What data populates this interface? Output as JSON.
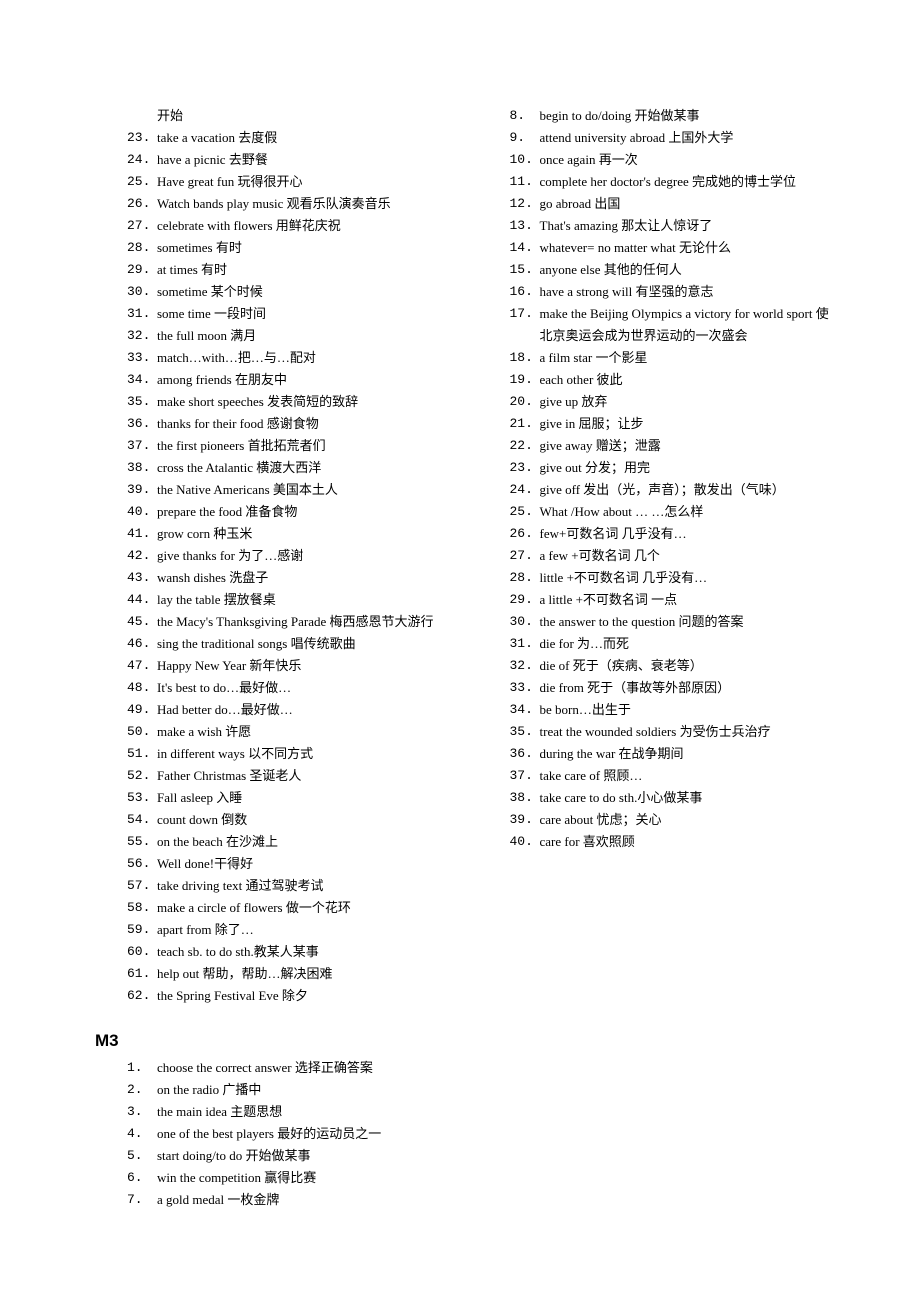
{
  "col1_first": {
    "text": "开始"
  },
  "col1": [
    {
      "n": "23.",
      "t": "take a vacation 去度假"
    },
    {
      "n": "24.",
      "t": " have a picnic 去野餐"
    },
    {
      "n": "25.",
      "t": "Have great fun 玩得很开心"
    },
    {
      "n": "26.",
      "t": "Watch bands play music 观看乐队演奏音乐"
    },
    {
      "n": "27.",
      "t": "celebrate with flowers 用鲜花庆祝"
    },
    {
      "n": "28.",
      "t": "sometimes 有时"
    },
    {
      "n": "29.",
      "t": "at times 有时"
    },
    {
      "n": "30.",
      "t": "sometime 某个时候"
    },
    {
      "n": "31.",
      "t": "some time 一段时间"
    },
    {
      "n": "32.",
      "t": "the full moon 满月"
    },
    {
      "n": "33.",
      "t": "match…with…把…与…配对"
    },
    {
      "n": "34.",
      "t": "among friends 在朋友中"
    },
    {
      "n": "35.",
      "t": "make short speeches 发表简短的致辞"
    },
    {
      "n": "36.",
      "t": "thanks for their food 感谢食物"
    },
    {
      "n": "37.",
      "t": "the first pioneers 首批拓荒者们"
    },
    {
      "n": "38.",
      "t": "cross the Atalantic 横渡大西洋"
    },
    {
      "n": "39.",
      "t": "the Native Americans 美国本土人"
    },
    {
      "n": "40.",
      "t": "prepare the food 准备食物"
    },
    {
      "n": "41.",
      "t": "grow corn 种玉米"
    },
    {
      "n": "42.",
      "t": "give thanks for 为了…感谢"
    },
    {
      "n": "43.",
      "t": "wansh dishes 洗盘子"
    },
    {
      "n": "44.",
      "t": "lay the table 摆放餐桌"
    },
    {
      "n": "45.",
      "t": "the Macy's Thanksgiving Parade 梅西感恩节大游行"
    },
    {
      "n": "46.",
      "t": "sing the traditional songs 唱传统歌曲"
    },
    {
      "n": "47.",
      "t": "Happy New Year 新年快乐"
    },
    {
      "n": "48.",
      "t": "It's best to do…最好做…"
    },
    {
      "n": "49.",
      "t": "Had better do…最好做…"
    },
    {
      "n": "50.",
      "t": "make a wish 许愿"
    },
    {
      "n": "51.",
      "t": "in different ways 以不同方式"
    },
    {
      "n": "52.",
      "t": "Father Christmas 圣诞老人"
    },
    {
      "n": "53.",
      "t": "Fall asleep 入睡"
    },
    {
      "n": "54.",
      "t": "count down 倒数"
    },
    {
      "n": "55.",
      "t": "on the beach 在沙滩上"
    },
    {
      "n": "56.",
      "t": "Well done!干得好"
    },
    {
      "n": "57.",
      "t": "take driving text 通过驾驶考试"
    },
    {
      "n": "58.",
      "t": "make a circle of flowers 做一个花环"
    },
    {
      "n": "59.",
      "t": "apart from 除了…"
    },
    {
      "n": "60.",
      "t": "teach sb. to do sth.教某人某事"
    },
    {
      "n": "61.",
      "t": "help out 帮助，帮助…解决困难"
    },
    {
      "n": "62.",
      "t": "the Spring Festival Eve 除夕"
    }
  ],
  "heading": "M3",
  "col2": [
    {
      "n": "1.",
      "t": "choose the correct answer 选择正确答案"
    },
    {
      "n": "2.",
      "t": "on the radio 广播中"
    },
    {
      "n": "3.",
      "t": "the main idea 主题思想"
    },
    {
      "n": "4.",
      "t": "one of the best players 最好的运动员之一"
    },
    {
      "n": "5.",
      "t": "start doing/to do 开始做某事"
    },
    {
      "n": "6.",
      "t": "win the competition 赢得比赛"
    },
    {
      "n": "7.",
      "t": "a gold medal 一枚金牌"
    },
    {
      "n": "8.",
      "t": "begin to do/doing 开始做某事"
    },
    {
      "n": "9.",
      "t": "attend university abroad 上国外大学"
    },
    {
      "n": "10.",
      "t": "once again 再一次"
    },
    {
      "n": "11.",
      "t": "complete her doctor's degree 完成她的博士学位"
    },
    {
      "n": "12.",
      "t": "go abroad 出国"
    },
    {
      "n": "13.",
      "t": "That's amazing 那太让人惊讶了"
    },
    {
      "n": "14.",
      "t": "whatever= no matter what 无论什么"
    },
    {
      "n": "15.",
      "t": "anyone else 其他的任何人"
    },
    {
      "n": "16.",
      "t": "have a strong will 有坚强的意志"
    },
    {
      "n": "17.",
      "t": "make the Beijing Olympics a victory for world sport 使北京奥运会成为世界运动的一次盛会"
    },
    {
      "n": "18.",
      "t": "a film star 一个影星"
    },
    {
      "n": "19.",
      "t": "each other 彼此"
    },
    {
      "n": "20.",
      "t": "give up 放弃"
    },
    {
      "n": "21.",
      "t": "give in 屈服；让步"
    },
    {
      "n": "22.",
      "t": "give away 赠送；泄露"
    },
    {
      "n": "23.",
      "t": "give out 分发；用完"
    },
    {
      "n": "24.",
      "t": "give off 发出（光，声音）；散发出（气味）"
    },
    {
      "n": "25.",
      "t": "What /How about …  …怎么样"
    },
    {
      "n": "26.",
      "t": "few+可数名词 几乎没有…"
    },
    {
      "n": "27.",
      "t": "a few +可数名词   几个"
    },
    {
      "n": "28.",
      "t": "little +不可数名词 几乎没有…"
    },
    {
      "n": "29.",
      "t": "a little +不可数名词  一点"
    },
    {
      "n": "30.",
      "t": "the answer to the question 问题的答案"
    },
    {
      "n": "31.",
      "t": "die for 为…而死"
    },
    {
      "n": "32.",
      "t": "die of 死于（疾病、衰老等）"
    },
    {
      "n": "33.",
      "t": "die from 死于（事故等外部原因）"
    },
    {
      "n": "34.",
      "t": "be born…出生于"
    },
    {
      "n": "35.",
      "t": "treat the wounded soldiers 为受伤士兵治疗"
    },
    {
      "n": "36.",
      "t": "during the war 在战争期间"
    },
    {
      "n": "37.",
      "t": "take care of 照顾…"
    },
    {
      "n": "38.",
      "t": "take care to do sth.小心做某事"
    },
    {
      "n": "39.",
      "t": "care about 忧虑；关心"
    },
    {
      "n": "40.",
      "t": "care for 喜欢照顾"
    }
  ]
}
